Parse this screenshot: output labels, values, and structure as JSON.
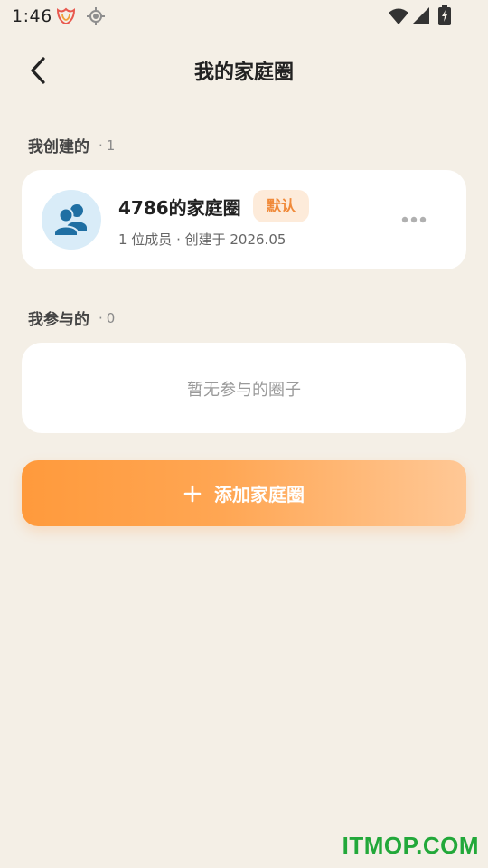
{
  "status_bar": {
    "time": "1:46",
    "icons": [
      "app-notification-icon",
      "location-icon",
      "wifi-icon",
      "cell-signal-icon",
      "battery-icon"
    ]
  },
  "header": {
    "back_icon": "chevron-left-icon",
    "title": "我的家庭圈"
  },
  "created_section": {
    "label": "我创建的",
    "separator": "·",
    "count": "1",
    "items": [
      {
        "avatar_icon": "family-members-icon",
        "name": "4786的家庭圈",
        "badge": "默认",
        "meta": "1 位成员 · 创建于 2026.05",
        "more_icon": "more-horizontal-icon"
      }
    ]
  },
  "joined_section": {
    "label": "我参与的",
    "separator": "·",
    "count": "0",
    "empty_text": "暂无参与的圈子"
  },
  "add_button": {
    "icon": "plus-icon",
    "label": "添加家庭圈"
  },
  "watermark": "ITMOP.COM",
  "colors": {
    "background": "#f4efe6",
    "accent": "#ff9a3c",
    "badge_bg": "#fdebda",
    "badge_text": "#f08a3a",
    "avatar_bg": "#d9ecf8",
    "avatar_icon": "#1f6fa3",
    "watermark": "#22a83a"
  }
}
